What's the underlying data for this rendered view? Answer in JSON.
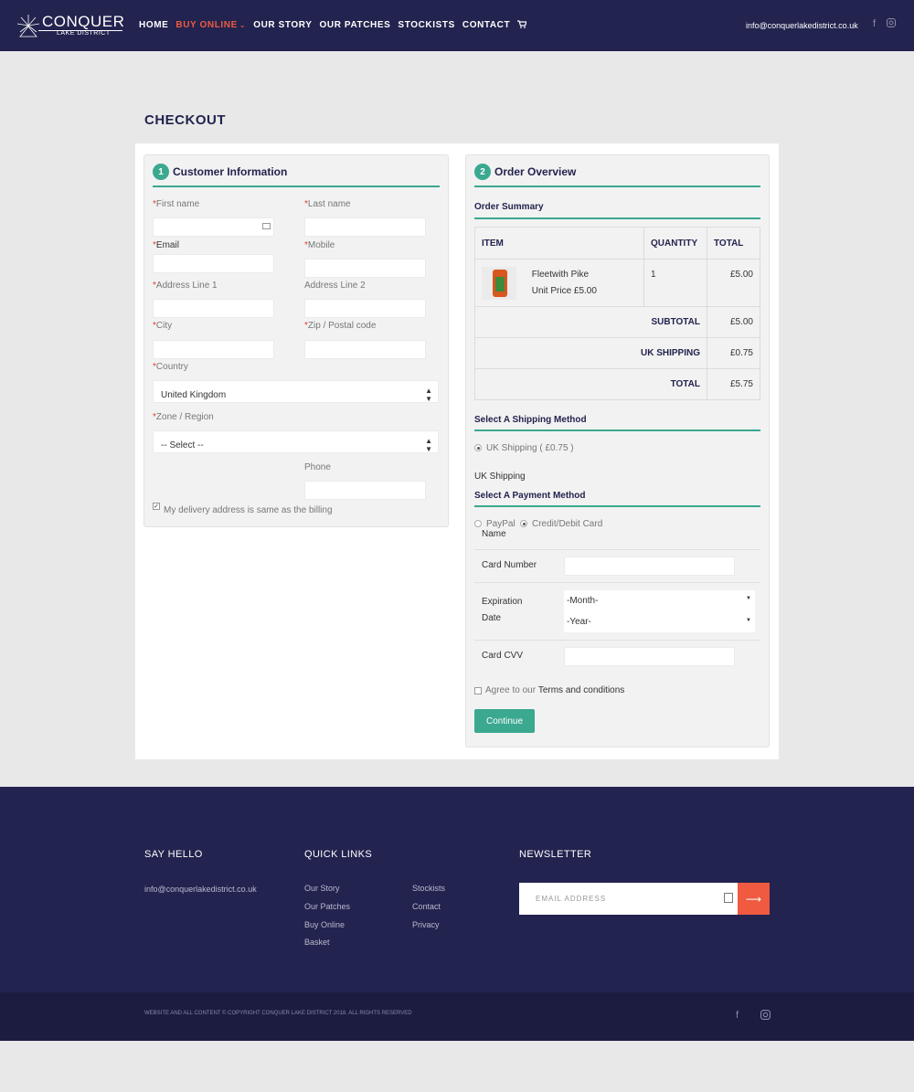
{
  "brand": {
    "name": "CONQUER",
    "tagline": "LAKE DISTRICT"
  },
  "nav": {
    "items": [
      {
        "label": "HOME"
      },
      {
        "label": "BUY ONLINE",
        "active": true
      },
      {
        "label": "OUR STORY"
      },
      {
        "label": "OUR PATCHES"
      },
      {
        "label": "STOCKISTS"
      },
      {
        "label": "CONTACT"
      }
    ],
    "cart_icon": "cart-icon",
    "email": "info@conquerlakedistrict.co.uk",
    "social": [
      "facebook-icon",
      "instagram-icon"
    ]
  },
  "checkout": {
    "title": "CHECKOUT",
    "customer": {
      "step": "1",
      "heading": "Customer Information",
      "first_name": "First name",
      "last_name": "Last name",
      "email": "Email",
      "mobile": "Mobile",
      "address1": "Address Line 1",
      "address2": "Address Line 2",
      "city": "City",
      "zip": "Zip / Postal code",
      "country_label": "Country",
      "country_value": "United Kingdom",
      "zone_label": "Zone / Region",
      "zone_value": "-- Select --",
      "phone": "Phone",
      "same_address": "My delivery address is same as the billing",
      "required_mark": "*"
    },
    "order": {
      "step": "2",
      "heading": "Order Overview",
      "summary_heading": "Order Summary",
      "columns": {
        "item": "ITEM",
        "quantity": "QUANTITY",
        "total": "TOTAL"
      },
      "line": {
        "name": "Fleetwith Pike",
        "unit_price": "Unit Price £5.00",
        "quantity": "1",
        "total": "£5.00"
      },
      "subtotal_label": "SUBTOTAL",
      "subtotal": "£5.00",
      "shipping_label": "UK SHIPPING",
      "shipping": "£0.75",
      "total_label": "TOTAL",
      "total": "£5.75",
      "shipping_heading": "Select A Shipping Method",
      "shipping_option": "UK Shipping ( £0.75 )",
      "shipping_selected": "UK Shipping",
      "payment_heading": "Select A Payment Method",
      "payment_paypal": "PayPal",
      "payment_card": "Credit/Debit Card",
      "name_label": "Name",
      "card_number_label": "Card Number",
      "expiry_label_1": "Expiration",
      "expiry_label_2": "Date",
      "month_value": "-Month-",
      "year_value": "-Year-",
      "cvv_label": "Card CVV",
      "agree_prefix": "Agree to our ",
      "agree_link": "Terms and conditions",
      "continue": "Continue"
    }
  },
  "footer": {
    "say_hello": "SAY HELLO",
    "email": "info@conquerlakedistrict.co.uk",
    "quick_links": "QUICK LINKS",
    "links_col1": [
      "Our Story",
      "Our Patches",
      "Buy Online",
      "Basket"
    ],
    "links_col2": [
      "Stockists",
      "Contact",
      "Privacy"
    ],
    "newsletter": "NEWSLETTER",
    "newsletter_placeholder": "EMAIL ADDRESS",
    "copyright": "WEBSITE AND ALL CONTENT © COPYRIGHT CONQUER LAKE DISTRICT 2018. ALL RIGHTS RESERVED"
  },
  "colors": {
    "navy": "#23234f",
    "teal": "#3ba890",
    "accent": "#ef5a40",
    "required": "#e23b2e"
  }
}
